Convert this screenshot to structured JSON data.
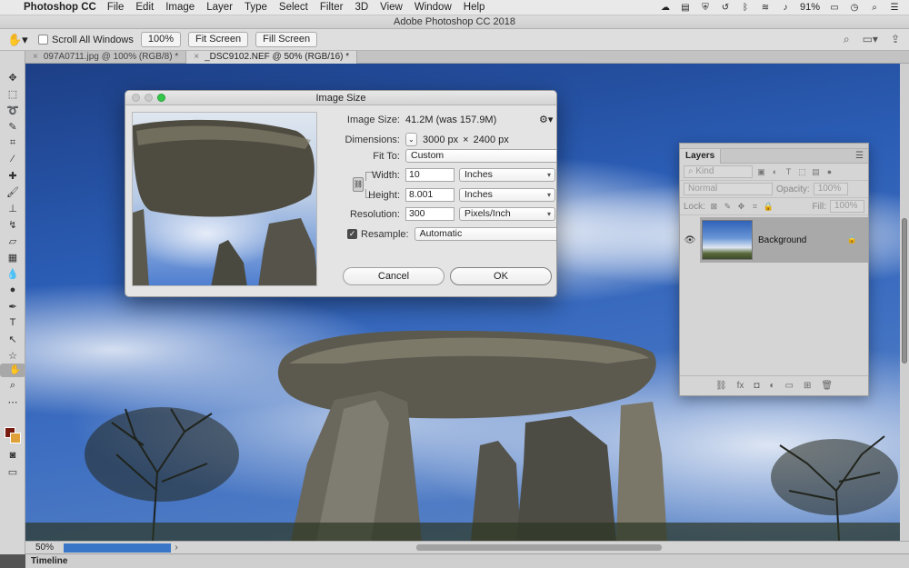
{
  "menubar": {
    "app_name": "Photoshop CC",
    "items": [
      "File",
      "Edit",
      "Image",
      "Layer",
      "Type",
      "Select",
      "Filter",
      "3D",
      "View",
      "Window",
      "Help"
    ],
    "battery": "91%"
  },
  "window": {
    "title": "Adobe Photoshop CC 2018"
  },
  "options_bar": {
    "scroll_all_windows": "Scroll All Windows",
    "zoom_100": "100%",
    "fit_screen": "Fit Screen",
    "fill_screen": "Fill Screen"
  },
  "tabs": [
    {
      "label": "097A0711.jpg @ 100% (RGB/8) *"
    },
    {
      "label": "_DSC9102.NEF @ 50% (RGB/16) *"
    }
  ],
  "status": {
    "zoom": "50%",
    "timeline": "Timeline",
    "progress_fraction": 0.55
  },
  "colors": {
    "foreground": "#7a1b12",
    "background": "#e0a13a",
    "accent": "#3a76c8"
  },
  "dialog": {
    "title": "Image Size",
    "image_size_label": "Image Size:",
    "image_size_value": "41.2M (was 157.9M)",
    "dimensions_label": "Dimensions:",
    "dim_w": "3000 px",
    "dim_x": "×",
    "dim_h": "2400 px",
    "fit_to_label": "Fit To:",
    "fit_to_value": "Custom",
    "width_label": "Width:",
    "width_value": "10",
    "width_unit": "Inches",
    "height_label": "Height:",
    "height_value": "8.001",
    "height_unit": "Inches",
    "resolution_label": "Resolution:",
    "resolution_value": "300",
    "resolution_unit": "Pixels/Inch",
    "resample_label": "Resample:",
    "resample_value": "Automatic",
    "cancel": "Cancel",
    "ok": "OK"
  },
  "layers_panel": {
    "tab": "Layers",
    "kind": "Kind",
    "blend_mode": "Normal",
    "opacity_label": "Opacity:",
    "opacity_value": "100%",
    "lock_label": "Lock:",
    "fill_label": "Fill:",
    "fill_value": "100%",
    "layers": [
      {
        "name": "Background",
        "locked": true,
        "visible": true
      }
    ]
  }
}
